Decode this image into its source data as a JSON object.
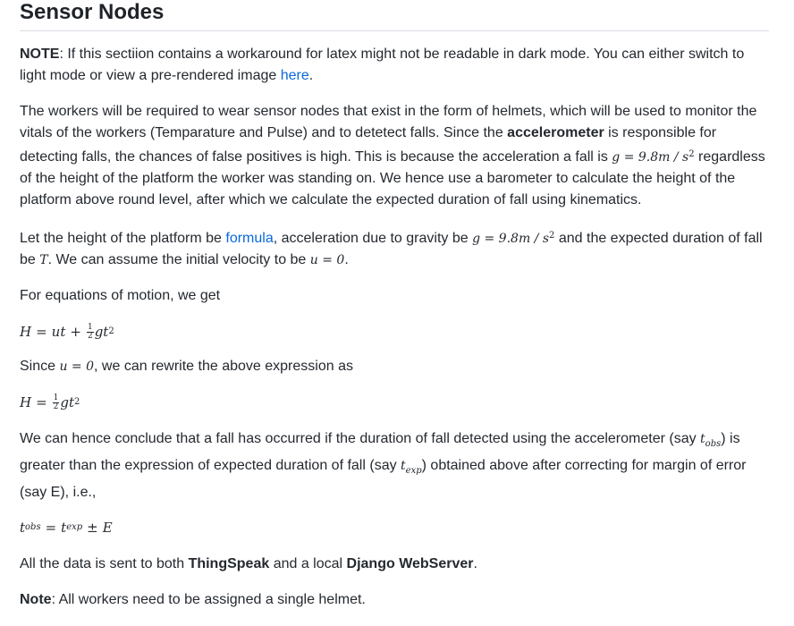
{
  "title": "Sensor Nodes",
  "note1": {
    "label": "NOTE",
    "text_a": ": If this sectiion contains a workaround for latex might not be readable in dark mode. You can either switch to light mode or view a pre-rendered image ",
    "link": "here",
    "text_b": "."
  },
  "para2": {
    "a": "The workers will be required to wear sensor nodes that exist in the form of helmets, which will be used to monitor the vitals of the workers (Temparature and Pulse) and to detetect falls. Since the ",
    "bold": "accelerometer",
    "b": " is responsible for detecting falls, the chances of false positives is high. This is because the acceleration a fall is ",
    "math": "g = 9.8m / s",
    "math_exp": "2",
    "c": " regardless of the height of the platform the worker was standing on. We hence use a barometer to calculate the height of the platform above round level, after which we calculate the expected duration of fall using kinematics."
  },
  "para3": {
    "a": "Let the height of the platform be ",
    "link": "formula",
    "b": ", acceleration due to gravity be ",
    "math1": "g = 9.8m / s",
    "math1_exp": "2",
    "c": " and the expected duration of fall be ",
    "math2": "T",
    "d": ". We can assume the initial velocity to be ",
    "math3": "u = 0",
    "e": "."
  },
  "para4": "For equations of motion, we get",
  "eq1": {
    "lhs": "H",
    "eq": "=",
    "term1": "ut",
    "plus": "+",
    "frac_num": "1",
    "frac_den": "2",
    "term2": "gt",
    "exp": "2"
  },
  "para5": {
    "a": "Since ",
    "math": "u = 0",
    "b": ", we can rewrite the above expression as"
  },
  "eq2": {
    "lhs": "H",
    "eq": "=",
    "frac_num": "1",
    "frac_den": "2",
    "term": "gt",
    "exp": "2"
  },
  "para6": {
    "a": "We can hence conclude that a fall has occurred if the duration of fall detected using the accelerometer (say ",
    "t_obs": "t",
    "t_obs_sub": "obs",
    "b": ") is greater than the expression of expected duration of fall (say ",
    "t_exp": "t",
    "t_exp_sub": "exp",
    "c": ") obtained above after correcting for margin of error (say E), i.e.,"
  },
  "eq3": {
    "lhs": "t",
    "lhs_sub": "obs",
    "eq": "=",
    "rhs": "t",
    "rhs_sub": "exp",
    "pm": "±",
    "e": "E"
  },
  "para7": {
    "a": "All the data is sent to both ",
    "bold1": "ThingSpeak",
    "b": " and a local ",
    "bold2": "Django WebServer",
    "c": "."
  },
  "note2": {
    "label": "Note",
    "text": ": All workers need to be assigned a single helmet."
  }
}
